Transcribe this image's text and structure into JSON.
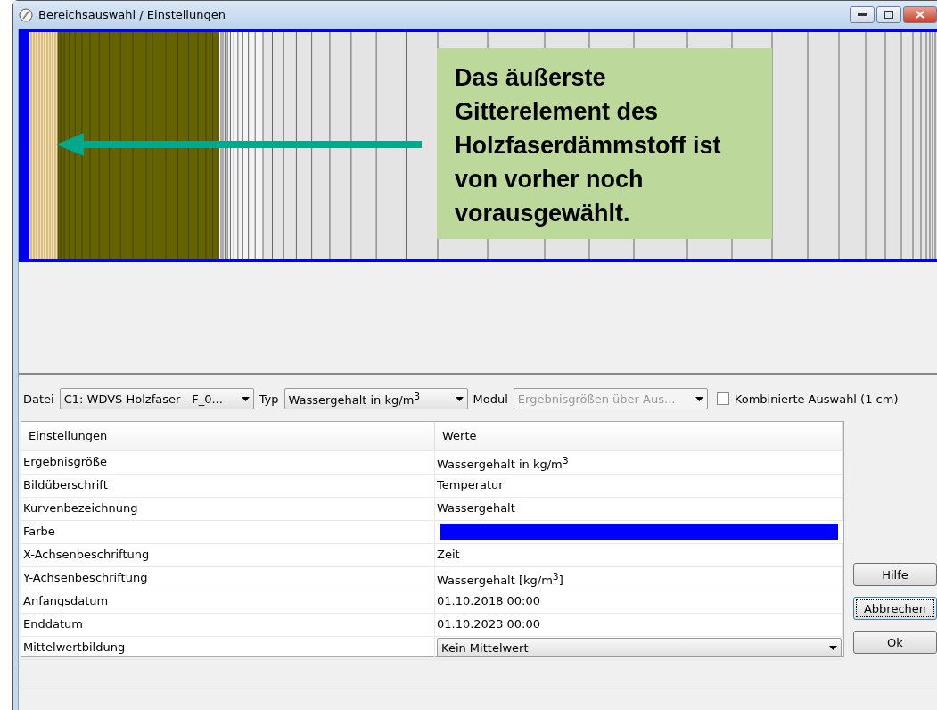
{
  "window": {
    "title": "Bereichsauswahl / Einstellungen"
  },
  "annotation": {
    "text": "Das äußerste Gitterelement des Holzfaserdämmstoff ist von vorher noch vorausgewählt."
  },
  "toolbar": {
    "file_label": "Datei",
    "file_value": "C1: WDVS Holzfaser - F_0...",
    "type_label": "Typ",
    "type_value": "Wassergehalt in kg/m$^{3}$",
    "module_label": "Modul",
    "module_value": "Ergebnisgrößen über Aus...",
    "module_disabled": true,
    "combined": {
      "label": "Kombinierte Auswahl (1 cm)",
      "checked": false
    }
  },
  "table": {
    "columns": [
      "Einstellungen",
      "Werte"
    ],
    "rows": [
      {
        "kind": "text",
        "name": "Ergebnisgröße",
        "value": "Wassergehalt in kg/m$^{3}$"
      },
      {
        "kind": "text",
        "name": "Bildüberschrift",
        "value": "Temperatur"
      },
      {
        "kind": "text",
        "name": "Kurvenbezeichnung",
        "value": "Wassergehalt"
      },
      {
        "kind": "color",
        "name": "Farbe",
        "color": "#0000ff"
      },
      {
        "kind": "text",
        "name": "X-Achsenbeschriftung",
        "value": "Zeit"
      },
      {
        "kind": "text",
        "name": "Y-Achsenbeschriftung",
        "value": "Wassergehalt [kg/m$^{3}$]"
      },
      {
        "kind": "text",
        "name": "Anfangsdatum",
        "value": "01.10.2018 00:00"
      },
      {
        "kind": "text",
        "name": "Enddatum",
        "value": "01.10.2023 00:00"
      },
      {
        "kind": "dropdown",
        "name": "Mittelwertbildung",
        "value": "Kein Mittelwert"
      }
    ]
  },
  "buttons": [
    {
      "label": "Hilfe",
      "focused": false
    },
    {
      "label": "Abbrechen",
      "focused": true
    },
    {
      "label": "Ok",
      "focused": false
    }
  ]
}
